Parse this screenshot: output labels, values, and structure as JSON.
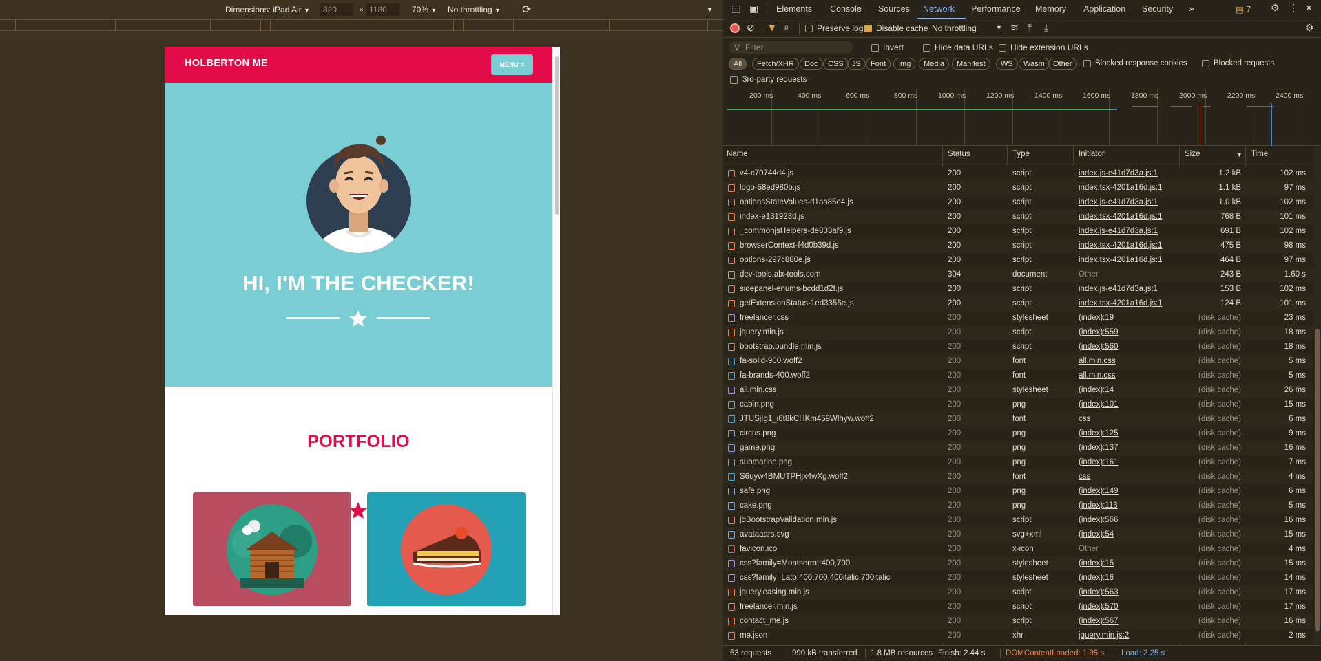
{
  "device_toolbar": {
    "dimensions": "Dimensions: iPad Air",
    "width": "820",
    "times": "×",
    "height": "1180",
    "zoom": "70%",
    "throttling": "No throttling"
  },
  "site": {
    "brand": "HOLBERTON ME",
    "menu_label": "MENU",
    "hero_title": "HI, I'M THE CHECKER!",
    "portfolio_title": "PORTFOLIO",
    "colors": {
      "primary": "#e30b48",
      "hero": "#79cdd3",
      "card1": "#b84d62",
      "card2": "#25a1b5"
    }
  },
  "devtools": {
    "tabs": [
      "Elements",
      "Console",
      "Sources",
      "Network",
      "Performance",
      "Memory",
      "Application",
      "Security"
    ],
    "active_tab": "Network",
    "more": "»",
    "issues_count": "7",
    "toolbar": {
      "preserve_log": "Preserve log",
      "disable_cache": "Disable cache",
      "throttling": "No throttling"
    },
    "filter": {
      "placeholder": "Filter",
      "invert": "Invert",
      "hide_data_urls": "Hide data URLs",
      "hide_extension_urls": "Hide extension URLs",
      "types": [
        "All",
        "Fetch/XHR",
        "Doc",
        "CSS",
        "JS",
        "Font",
        "Img",
        "Media",
        "Manifest",
        "WS",
        "Wasm",
        "Other"
      ],
      "blocked_cookies": "Blocked response cookies",
      "blocked_requests": "Blocked requests",
      "third_party": "3rd-party requests"
    },
    "timeline_labels": [
      "200 ms",
      "400 ms",
      "600 ms",
      "800 ms",
      "1000 ms",
      "1200 ms",
      "1400 ms",
      "1600 ms",
      "1800 ms",
      "2000 ms",
      "2200 ms",
      "2400 ms"
    ],
    "columns": [
      "Name",
      "Status",
      "Type",
      "Initiator",
      "Size",
      "Time"
    ],
    "rows": [
      {
        "name": "v4-c70744d4.js",
        "status": "200",
        "type": "script",
        "initiator": "index.js-e41d7d3a.js:1",
        "size": "1.2 kB",
        "time": "102 ms",
        "icon": "script"
      },
      {
        "name": "logo-58ed980b.js",
        "status": "200",
        "type": "script",
        "initiator": "index.tsx-4201a16d.js:1",
        "size": "1.1 kB",
        "time": "97 ms",
        "icon": "script"
      },
      {
        "name": "optionsStateValues-d1aa85e4.js",
        "status": "200",
        "type": "script",
        "initiator": "index.js-e41d7d3a.js:1",
        "size": "1.0 kB",
        "time": "102 ms",
        "icon": "script"
      },
      {
        "name": "index-e131923d.js",
        "status": "200",
        "type": "script",
        "initiator": "index.tsx-4201a16d.js:1",
        "size": "768 B",
        "time": "101 ms",
        "icon": "script"
      },
      {
        "name": "_commonjsHelpers-de833af9.js",
        "status": "200",
        "type": "script",
        "initiator": "index.js-e41d7d3a.js:1",
        "size": "691 B",
        "time": "102 ms",
        "icon": "script"
      },
      {
        "name": "browserContext-f4d0b39d.js",
        "status": "200",
        "type": "script",
        "initiator": "index.tsx-4201a16d.js:1",
        "size": "475 B",
        "time": "98 ms",
        "icon": "script"
      },
      {
        "name": "options-297c880e.js",
        "status": "200",
        "type": "script",
        "initiator": "index.tsx-4201a16d.js:1",
        "size": "464 B",
        "time": "97 ms",
        "icon": "script"
      },
      {
        "name": "dev-tools.alx-tools.com",
        "status": "304",
        "type": "document",
        "initiator": "Other",
        "size": "243 B",
        "time": "1.60 s",
        "icon": "document"
      },
      {
        "name": "sidepanel-enums-bcdd1d2f.js",
        "status": "200",
        "type": "script",
        "initiator": "index.js-e41d7d3a.js:1",
        "size": "153 B",
        "time": "102 ms",
        "icon": "script"
      },
      {
        "name": "getExtensionStatus-1ed3356e.js",
        "status": "200",
        "type": "script",
        "initiator": "index.tsx-4201a16d.js:1",
        "size": "124 B",
        "time": "101 ms",
        "icon": "script"
      },
      {
        "name": "freelancer.css",
        "status": "200",
        "type": "stylesheet",
        "initiator": "(index):19",
        "size": "(disk cache)",
        "time": "23 ms",
        "icon": "stylesheet"
      },
      {
        "name": "jquery.min.js",
        "status": "200",
        "type": "script",
        "initiator": "(index):559",
        "size": "(disk cache)",
        "time": "18 ms",
        "icon": "script"
      },
      {
        "name": "bootstrap.bundle.min.js",
        "status": "200",
        "type": "script",
        "initiator": "(index):560",
        "size": "(disk cache)",
        "time": "18 ms",
        "icon": "script"
      },
      {
        "name": "fa-solid-900.woff2",
        "status": "200",
        "type": "font",
        "initiator": "all.min.css",
        "size": "(disk cache)",
        "time": "5 ms",
        "icon": "font"
      },
      {
        "name": "fa-brands-400.woff2",
        "status": "200",
        "type": "font",
        "initiator": "all.min.css",
        "size": "(disk cache)",
        "time": "5 ms",
        "icon": "font"
      },
      {
        "name": "all.min.css",
        "status": "200",
        "type": "stylesheet",
        "initiator": "(index):14",
        "size": "(disk cache)",
        "time": "26 ms",
        "icon": "stylesheet"
      },
      {
        "name": "cabin.png",
        "status": "200",
        "type": "png",
        "initiator": "(index):101",
        "size": "(disk cache)",
        "time": "15 ms",
        "icon": "image"
      },
      {
        "name": "JTUSjIg1_i6t8kCHKm459Wlhyw.woff2",
        "status": "200",
        "type": "font",
        "initiator": "css",
        "size": "(disk cache)",
        "time": "6 ms",
        "icon": "font"
      },
      {
        "name": "circus.png",
        "status": "200",
        "type": "png",
        "initiator": "(index):125",
        "size": "(disk cache)",
        "time": "9 ms",
        "icon": "image"
      },
      {
        "name": "game.png",
        "status": "200",
        "type": "png",
        "initiator": "(index):137",
        "size": "(disk cache)",
        "time": "16 ms",
        "icon": "image"
      },
      {
        "name": "submarine.png",
        "status": "200",
        "type": "png",
        "initiator": "(index):161",
        "size": "(disk cache)",
        "time": "7 ms",
        "icon": "image"
      },
      {
        "name": "S6uyw4BMUTPHjx4wXg.woff2",
        "status": "200",
        "type": "font",
        "initiator": "css",
        "size": "(disk cache)",
        "time": "4 ms",
        "icon": "font"
      },
      {
        "name": "safe.png",
        "status": "200",
        "type": "png",
        "initiator": "(index):149",
        "size": "(disk cache)",
        "time": "6 ms",
        "icon": "image"
      },
      {
        "name": "cake.png",
        "status": "200",
        "type": "png",
        "initiator": "(index):113",
        "size": "(disk cache)",
        "time": "5 ms",
        "icon": "image"
      },
      {
        "name": "jqBootstrapValidation.min.js",
        "status": "200",
        "type": "script",
        "initiator": "(index):566",
        "size": "(disk cache)",
        "time": "16 ms",
        "icon": "script"
      },
      {
        "name": "avataaars.svg",
        "status": "200",
        "type": "svg+xml",
        "initiator": "(index):54",
        "size": "(disk cache)",
        "time": "15 ms",
        "icon": "image"
      },
      {
        "name": "favicon.ico",
        "status": "200",
        "type": "x-icon",
        "initiator": "Other",
        "size": "(disk cache)",
        "time": "4 ms",
        "icon": "favicon"
      },
      {
        "name": "css?family=Montserrat:400,700",
        "status": "200",
        "type": "stylesheet",
        "initiator": "(index):15",
        "size": "(disk cache)",
        "time": "15 ms",
        "icon": "stylesheet"
      },
      {
        "name": "css?family=Lato:400,700,400italic,700italic",
        "status": "200",
        "type": "stylesheet",
        "initiator": "(index):16",
        "size": "(disk cache)",
        "time": "14 ms",
        "icon": "stylesheet"
      },
      {
        "name": "jquery.easing.min.js",
        "status": "200",
        "type": "script",
        "initiator": "(index):563",
        "size": "(disk cache)",
        "time": "17 ms",
        "icon": "script"
      },
      {
        "name": "freelancer.min.js",
        "status": "200",
        "type": "script",
        "initiator": "(index):570",
        "size": "(disk cache)",
        "time": "17 ms",
        "icon": "script"
      },
      {
        "name": "contact_me.js",
        "status": "200",
        "type": "script",
        "initiator": "(index):567",
        "size": "(disk cache)",
        "time": "16 ms",
        "icon": "script"
      },
      {
        "name": "me.json",
        "status": "200",
        "type": "xhr",
        "initiator": "jquery.min.js:2",
        "size": "(disk cache)",
        "time": "2 ms",
        "icon": "xhr"
      }
    ],
    "status_bar": {
      "requests": "53 requests",
      "transferred": "990 kB transferred",
      "resources": "1.8 MB resources",
      "finish": "Finish: 2.44 s",
      "dom_loaded": "DOMContentLoaded: 1.95 s",
      "load": "Load: 2.25 s"
    }
  }
}
